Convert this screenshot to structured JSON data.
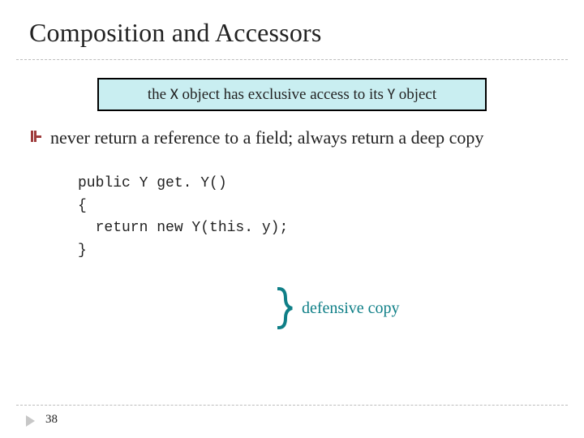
{
  "title": "Composition and Accessors",
  "callout": {
    "prefix": "the ",
    "code1": "X",
    "mid": " object has exclusive access to its ",
    "code2": "Y",
    "suffix": " object"
  },
  "bullet": "never return a reference to a field; always return a deep copy",
  "code": {
    "line1": "public Y get. Y()",
    "line2": "{",
    "line3": "  return new Y(this. y);",
    "line4": "}"
  },
  "annotation_label": "defensive copy",
  "page_number": "38"
}
